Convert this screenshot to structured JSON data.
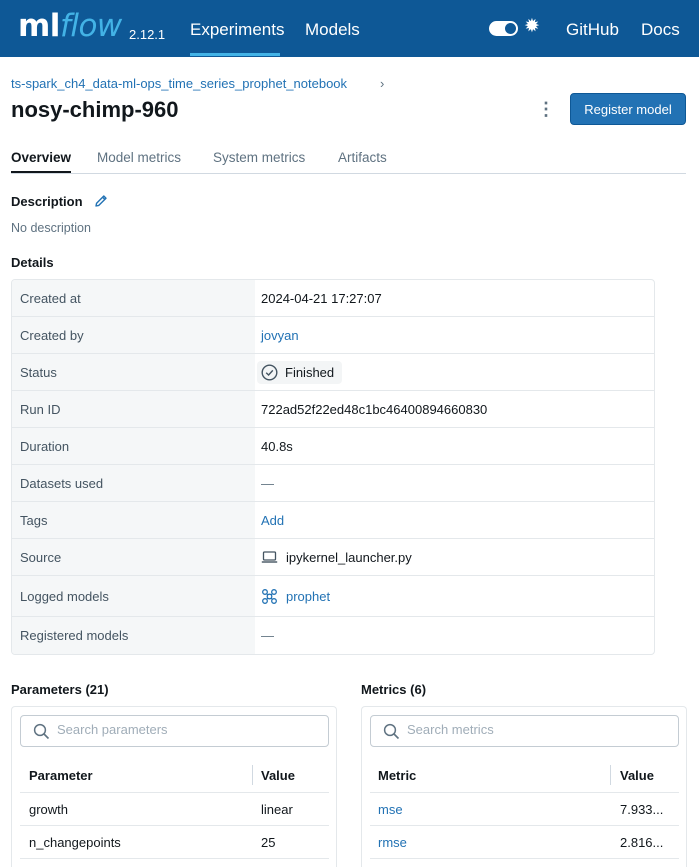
{
  "header": {
    "logo_ml": "ml",
    "logo_flow": "flow",
    "version": "2.12.1",
    "nav": {
      "experiments": "Experiments",
      "models": "Models",
      "github": "GitHub",
      "docs": "Docs"
    },
    "accent_color": "#0e5896"
  },
  "page": {
    "breadcrumb": "ts-spark_ch4_data-ml-ops_time_series_prophet_notebook",
    "breadcrumb_chevron": "›",
    "title": "nosy-chimp-960",
    "register_label": "Register model",
    "kebab_label": "⋮"
  },
  "tabs": [
    "Overview",
    "Model metrics",
    "System metrics",
    "Artifacts"
  ],
  "description": {
    "heading": "Description",
    "text": "No description"
  },
  "details": {
    "heading": "Details",
    "created_at_label": "Created at",
    "created_at": "2024-04-21 17:27:07",
    "created_by_label": "Created by",
    "created_by": "jovyan",
    "status_label": "Status",
    "status": "Finished",
    "run_id_label": "Run ID",
    "run_id": "722ad52f22ed48c1bc46400894660830",
    "duration_label": "Duration",
    "duration": "40.8s",
    "datasets_label": "Datasets used",
    "datasets": "—",
    "tags_label": "Tags",
    "tags": "Add",
    "source_label": "Source",
    "source": "ipykernel_launcher.py",
    "logged_models_label": "Logged models",
    "logged_models": "prophet",
    "registered_models_label": "Registered models",
    "registered_models": "—"
  },
  "parameters": {
    "heading": "Parameters (21)",
    "search_placeholder": "Search parameters",
    "col_name": "Parameter",
    "col_value": "Value",
    "rows": [
      {
        "name": "growth",
        "value": "linear"
      },
      {
        "name": "n_changepoints",
        "value": "25"
      }
    ]
  },
  "metrics": {
    "heading": "Metrics (6)",
    "search_placeholder": "Search metrics",
    "col_name": "Metric",
    "col_value": "Value",
    "rows": [
      {
        "name": "mse",
        "value": "7.933..."
      },
      {
        "name": "rmse",
        "value": "2.816..."
      }
    ]
  }
}
